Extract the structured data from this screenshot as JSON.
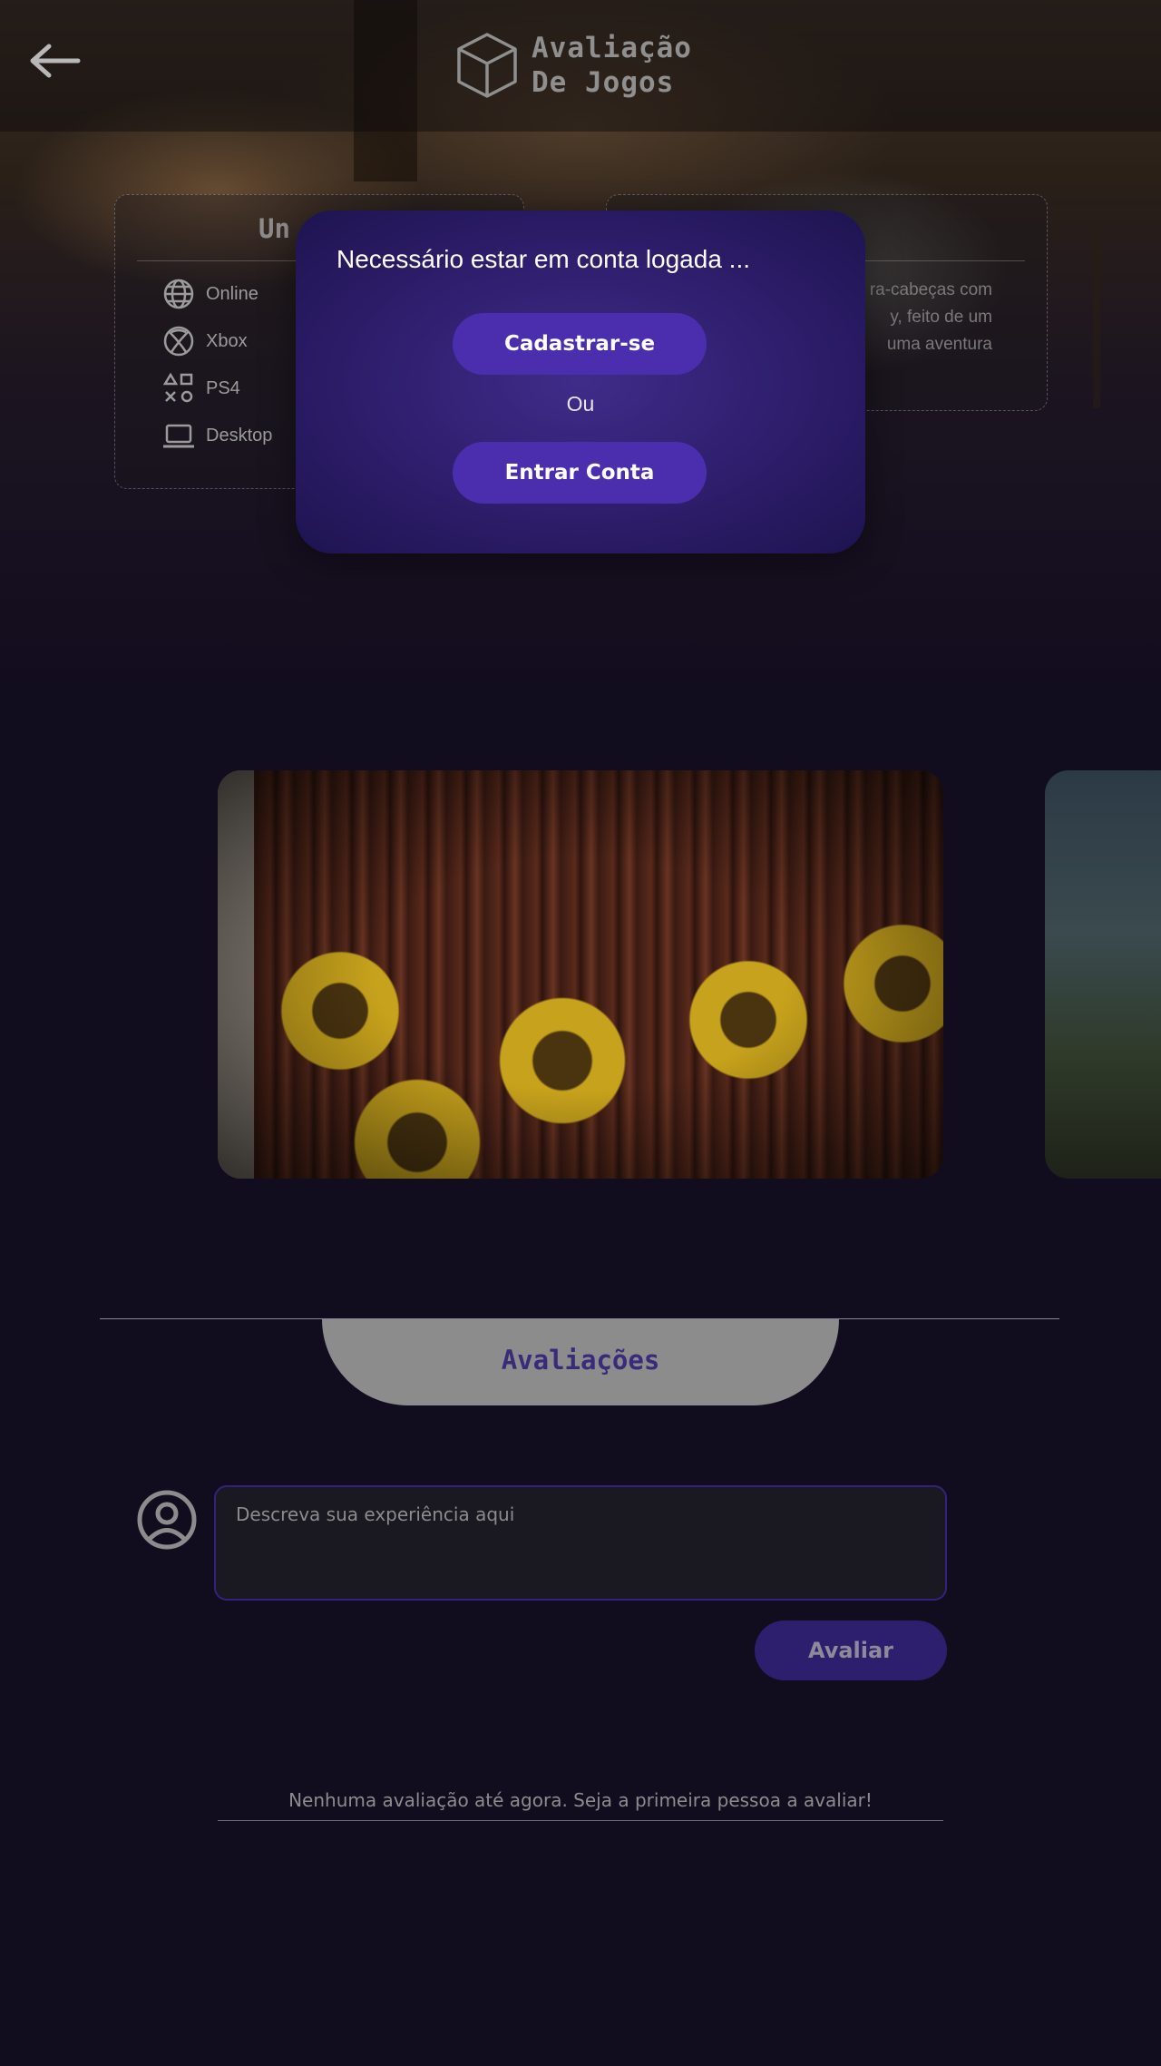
{
  "header": {
    "back_icon": "arrow-left-icon",
    "logo_icon": "cube-icon",
    "title_line1": "Avaliação",
    "title_line2": "De Jogos"
  },
  "platforms_card": {
    "title": "Un",
    "items": [
      {
        "icon": "globe-icon",
        "label": "Online"
      },
      {
        "icon": "xbox-icon",
        "label": "Xbox"
      },
      {
        "icon": "playstation-icon",
        "label": "PS4"
      },
      {
        "icon": "laptop-icon",
        "label": "Desktop"
      }
    ]
  },
  "description_card": {
    "lines": [
      "ra-cabeças com",
      "y, feito de um",
      "uma aventura"
    ]
  },
  "modal": {
    "message": "Necessário estar em conta logada ...",
    "signup_label": "Cadastrar-se",
    "or_label": "Ou",
    "login_label": "Entrar Conta"
  },
  "reviews": {
    "section_title": "Avaliações",
    "avatar_icon": "user-circle-icon",
    "input_placeholder": "Descreva sua experiência aqui",
    "submit_label": "Avaliar",
    "empty_message": "Nenhuma avaliação até agora. Seja a primeira pessoa a avaliar!"
  },
  "colors": {
    "background": "#120c1f",
    "modal": "#3f2c8a",
    "accent": "#4a2eae",
    "section_tab": "#8c8c8c"
  }
}
